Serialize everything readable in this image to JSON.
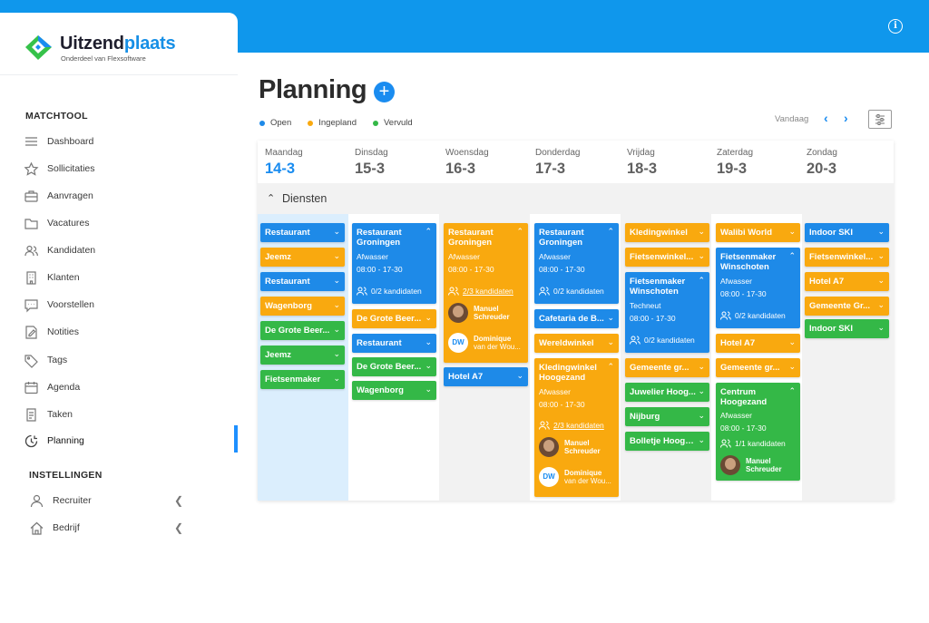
{
  "header": {
    "info_icon": "info-icon"
  },
  "brand": {
    "name_part1": "Uitzend",
    "name_part2": "plaats",
    "subtitle": "Onderdeel van Flexsoftware"
  },
  "sidebar": {
    "section1": "MATCHTOOL",
    "items": [
      {
        "label": "Dashboard",
        "icon": "dashboard-icon"
      },
      {
        "label": "Sollicitaties",
        "icon": "star-icon"
      },
      {
        "label": "Aanvragen",
        "icon": "briefcase-icon"
      },
      {
        "label": "Vacatures",
        "icon": "folder-icon"
      },
      {
        "label": "Kandidaten",
        "icon": "users-icon"
      },
      {
        "label": "Klanten",
        "icon": "building-icon"
      },
      {
        "label": "Voorstellen",
        "icon": "chat-icon"
      },
      {
        "label": "Notities",
        "icon": "note-icon"
      },
      {
        "label": "Tags",
        "icon": "tag-icon"
      },
      {
        "label": "Agenda",
        "icon": "calendar-icon"
      },
      {
        "label": "Taken",
        "icon": "tasks-icon"
      },
      {
        "label": "Planning",
        "icon": "planning-icon",
        "active": true
      }
    ],
    "section2": "INSTELLINGEN",
    "settings": [
      {
        "label": "Recruiter",
        "icon": "user-icon"
      },
      {
        "label": "Bedrijf",
        "icon": "home-icon"
      }
    ]
  },
  "page": {
    "title": "Planning",
    "add_label": "+"
  },
  "legend": [
    {
      "label": "Open",
      "color": "#1e8ae8"
    },
    {
      "label": "Ingepland",
      "color": "#f9a90f"
    },
    {
      "label": "Vervuld",
      "color": "#34b847"
    }
  ],
  "toolbar": {
    "today_label": "Vandaag",
    "prev": "‹",
    "next": "›"
  },
  "calendar": {
    "days": [
      {
        "name": "Maandag",
        "date": "14-3"
      },
      {
        "name": "Dinsdag",
        "date": "15-3"
      },
      {
        "name": "Woensdag",
        "date": "16-3"
      },
      {
        "name": "Donderdag",
        "date": "17-3"
      },
      {
        "name": "Vrijdag",
        "date": "18-3"
      },
      {
        "name": "Zaterdag",
        "date": "19-3"
      },
      {
        "name": "Zondag",
        "date": "20-3"
      }
    ],
    "section_label": "Diensten",
    "candidates": {
      "manuel_first": "Manuel",
      "manuel_last": "Schreuder",
      "dw_initials": "DW",
      "dominique_first": "Dominique",
      "dominique_last": "van der Wou..."
    },
    "mon": [
      "Restaurant",
      "Jeemz",
      "Restaurant",
      "Wagenborg",
      "De Grote Beer...",
      "Jeemz",
      "Fietsenmaker"
    ],
    "tue": {
      "expanded": {
        "title": "Restaurant Groningen",
        "sub": "Afwasser",
        "time": "08:00 - 17-30",
        "kandidaten": "0/2 kandidaten"
      },
      "items": [
        "De Grote Beer...",
        "Restaurant",
        "De Grote Beer...",
        "Wagenborg"
      ]
    },
    "wed": {
      "expanded": {
        "title": "Restaurant Groningen",
        "sub": "Afwasser",
        "time": "08:00 - 17-30",
        "kandidaten": "2/3 kandidaten"
      },
      "items": [
        "Hotel A7"
      ]
    },
    "thu": {
      "expanded1": {
        "title": "Restaurant Groningen",
        "sub": "Afwasser",
        "time": "08:00 - 17-30",
        "kandidaten": "0/2 kandidaten"
      },
      "items": [
        "Cafetaria de B...",
        "Wereldwinkel"
      ],
      "expanded2": {
        "title": "Kledingwinkel Hoogezand",
        "sub": "Afwasser",
        "time": "08:00 - 17-30",
        "kandidaten": "2/3 kandidaten"
      }
    },
    "fri": {
      "items_top": [
        "Kledingwinkel",
        "Fietsenwinkel..."
      ],
      "expanded": {
        "title": "Fietsenmaker Winschoten",
        "sub": "Techneut",
        "time": "08:00 - 17-30",
        "kandidaten": "0/2 kandidaten"
      },
      "items_bottom": [
        "Gemeente gr...",
        "Juwelier Hoog...",
        "Nijburg",
        "Bolletje Hooge..."
      ]
    },
    "sat": {
      "items_top": [
        "Walibi World"
      ],
      "expanded": {
        "title": "Fietsenmaker Winschoten",
        "sub": "Afwasser",
        "time": "08:00 - 17-30",
        "kandidaten": "0/2 kandidaten"
      },
      "items_mid": [
        "Hotel A7",
        "Gemeente gr..."
      ],
      "expanded2": {
        "title": "Centrum Hoogezand",
        "sub": "Afwasser",
        "time": "08:00 - 17-30",
        "kandidaten": "1/1 kandidaten"
      }
    },
    "sun": [
      "Indoor SKI",
      "Fietsenwinkel...",
      "Hotel A7",
      "Gemeente Gr...",
      "Indoor SKI"
    ]
  }
}
